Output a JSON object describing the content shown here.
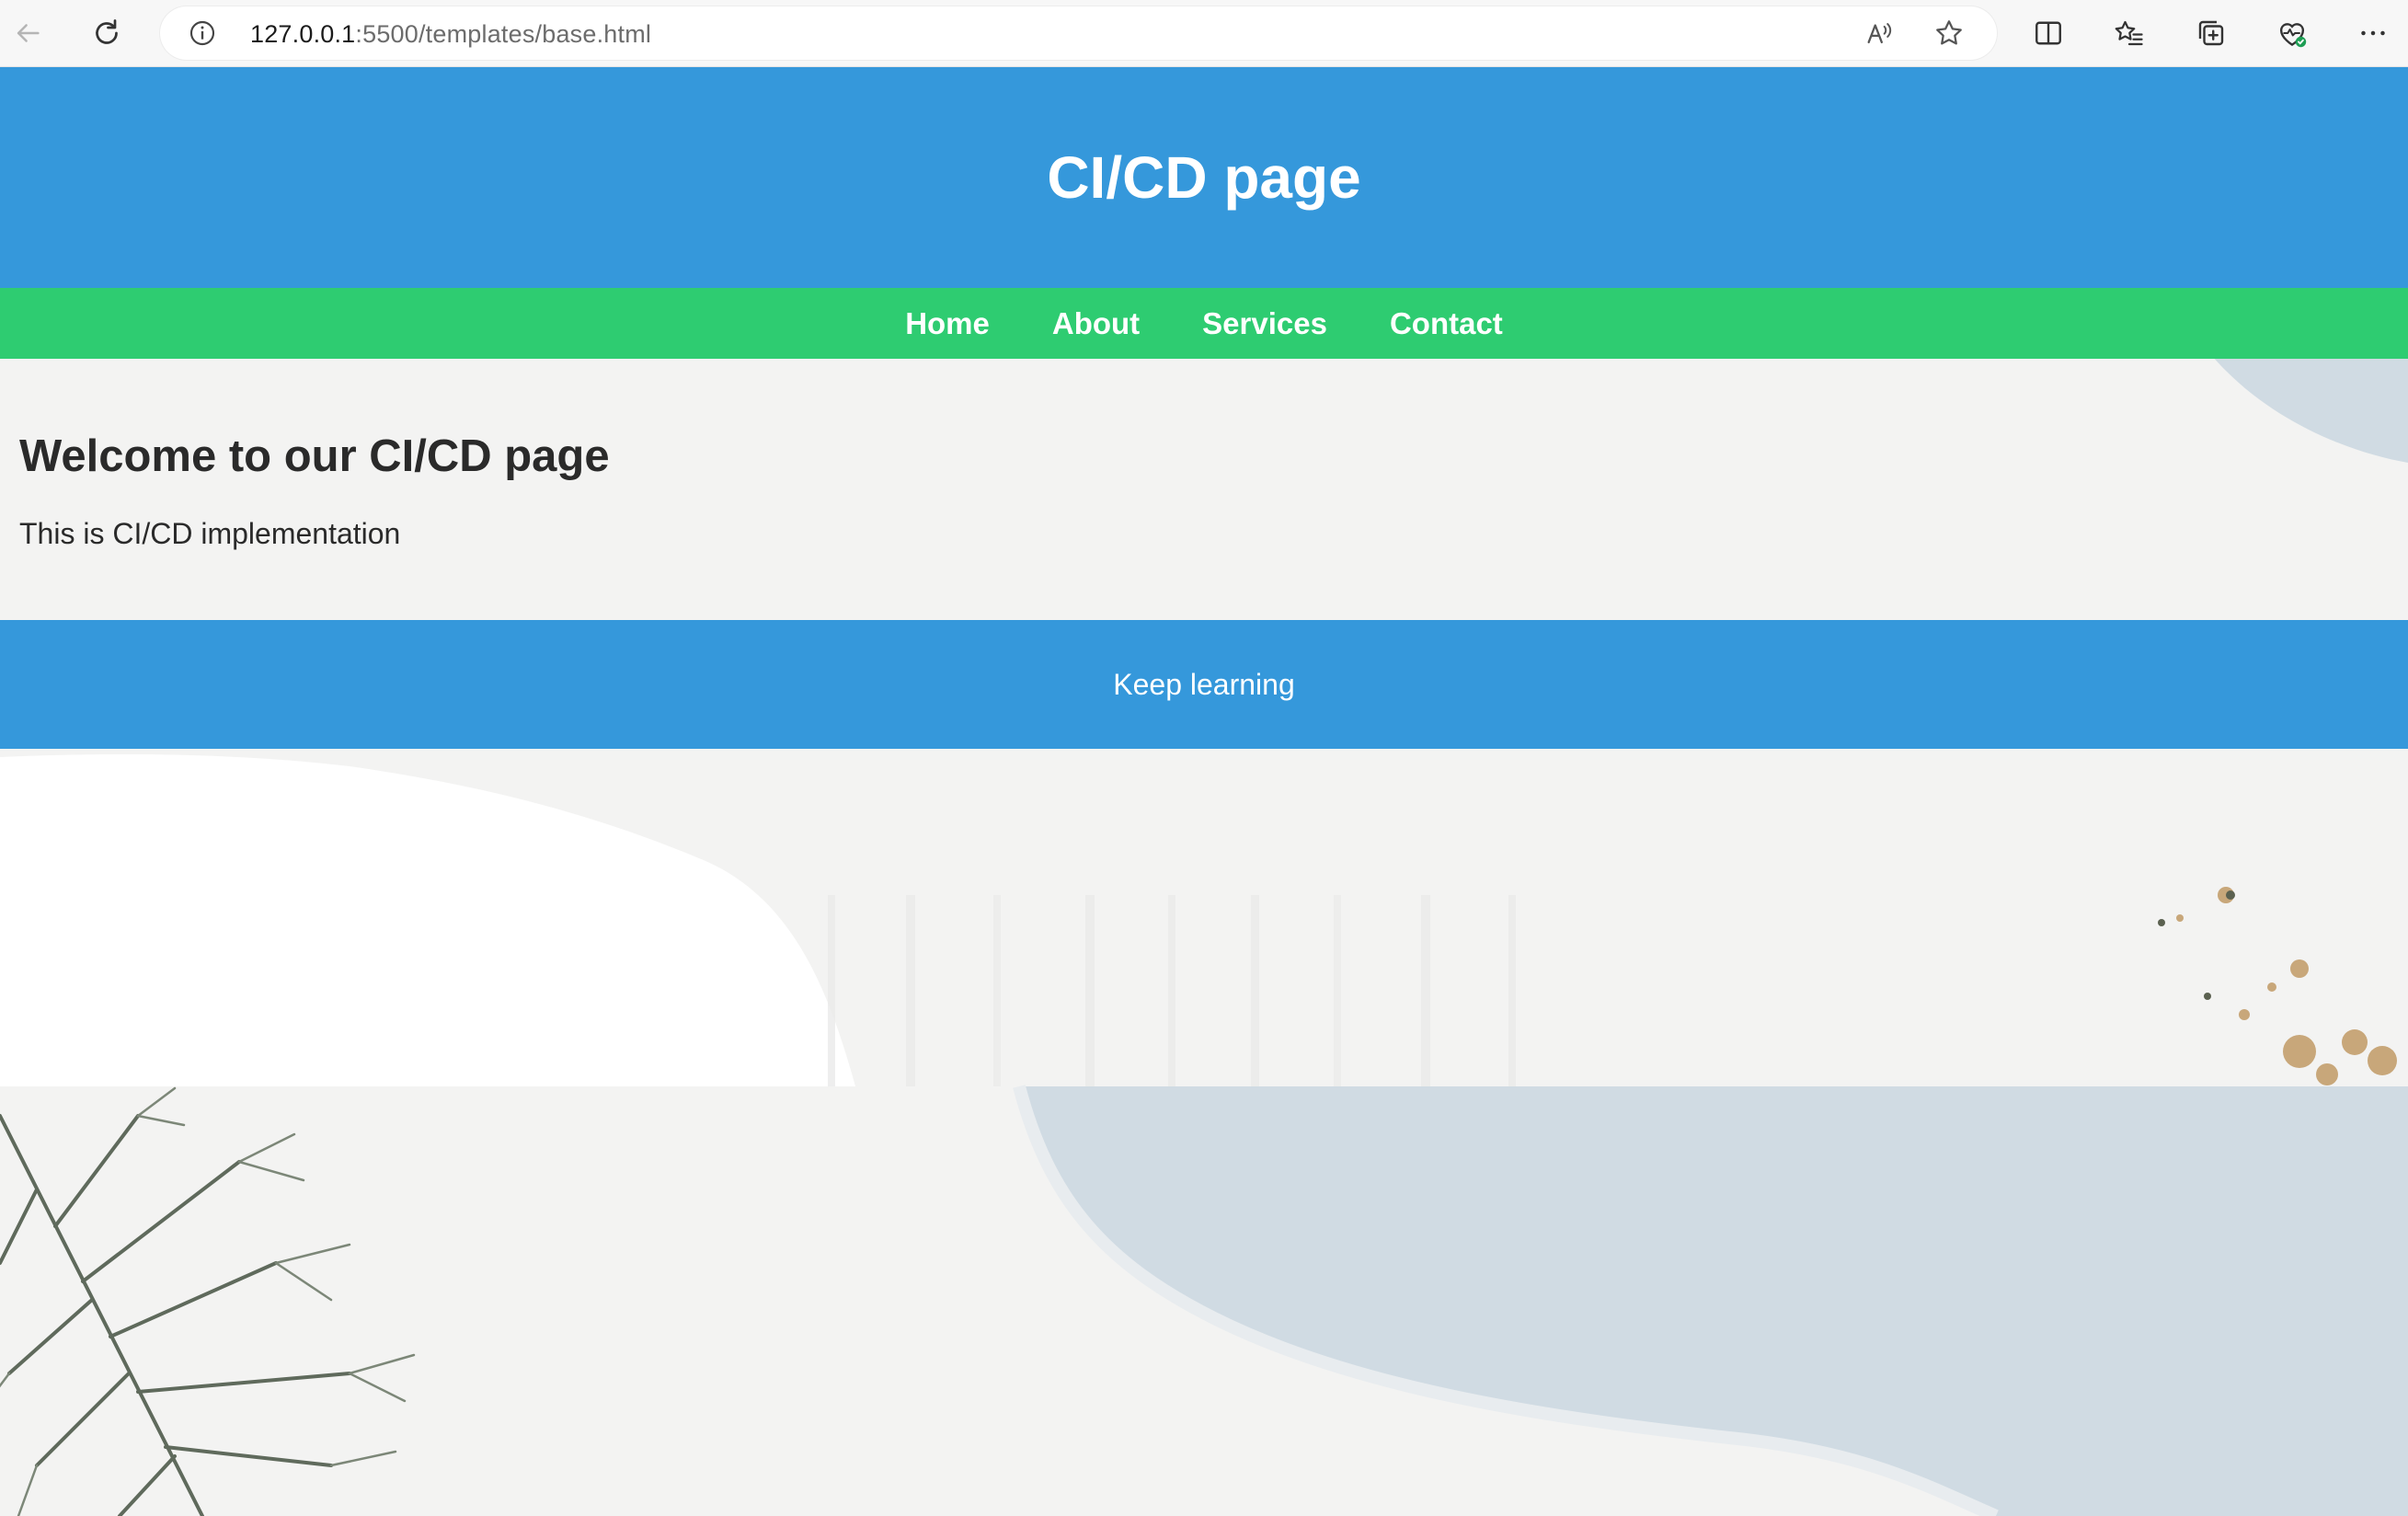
{
  "browser": {
    "url_host": "127.0.0.1",
    "url_path": ":5500/templates/base.html",
    "icons": [
      "back-arrow-icon",
      "refresh-icon",
      "info-icon",
      "read-aloud-icon",
      "favorite-star-icon",
      "split-screen-icon",
      "favorites-list-icon",
      "collections-icon",
      "browser-essentials-icon",
      "more-menu-icon"
    ]
  },
  "header": {
    "title": "CI/CD page"
  },
  "nav": {
    "items": [
      {
        "label": "Home"
      },
      {
        "label": "About"
      },
      {
        "label": "Services"
      },
      {
        "label": "Contact"
      }
    ]
  },
  "main": {
    "heading": "Welcome to our CI/CD page",
    "text": "This is CI/CD implementation"
  },
  "footer": {
    "text": "Keep learning"
  },
  "colors": {
    "header_bg": "#3598db",
    "nav_bg": "#2ecc71",
    "footer_bg": "#3598db",
    "page_bg": "#f3f3f2",
    "heading_text": "#2a2a2a"
  }
}
